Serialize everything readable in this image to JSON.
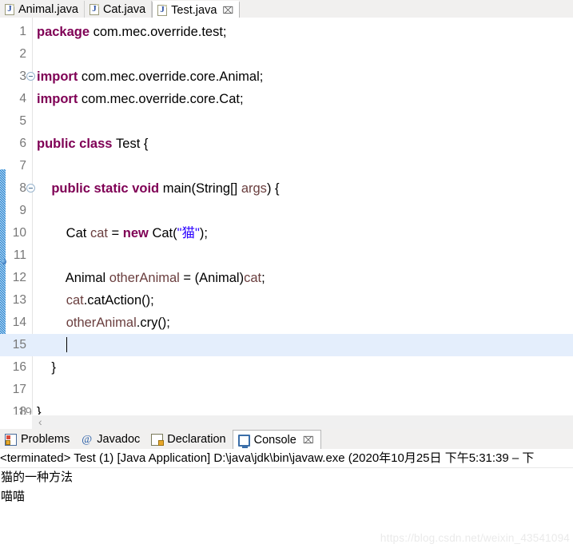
{
  "editor_tabs": [
    {
      "label": "Animal.java",
      "icon": "java-file-icon",
      "active": false,
      "closeable": false
    },
    {
      "label": "Cat.java",
      "icon": "java-file-icon",
      "active": false,
      "closeable": false
    },
    {
      "label": "Test.java",
      "icon": "java-file-icon",
      "active": true,
      "closeable": true,
      "close_glyph": "⌧"
    }
  ],
  "editor": {
    "filename": "Test.java",
    "cursor_line": 15,
    "partial_line_number": "19",
    "scroll_left_arrow": "‹",
    "lines": [
      {
        "num": "1",
        "fold": false,
        "tokens": [
          {
            "t": "package ",
            "c": "kw"
          },
          {
            "t": "com.mec.override.test;",
            "c": "plain"
          }
        ]
      },
      {
        "num": "2",
        "fold": false,
        "tokens": []
      },
      {
        "num": "3",
        "fold": true,
        "tokens": [
          {
            "t": "import ",
            "c": "kw"
          },
          {
            "t": "com.mec.override.core.Animal;",
            "c": "plain"
          }
        ]
      },
      {
        "num": "4",
        "fold": false,
        "tokens": [
          {
            "t": "import ",
            "c": "kw"
          },
          {
            "t": "com.mec.override.core.Cat;",
            "c": "plain"
          }
        ]
      },
      {
        "num": "5",
        "fold": false,
        "tokens": []
      },
      {
        "num": "6",
        "fold": false,
        "tokens": [
          {
            "t": "public class ",
            "c": "kw"
          },
          {
            "t": "Test {",
            "c": "plain"
          }
        ]
      },
      {
        "num": "7",
        "fold": false,
        "tokens": []
      },
      {
        "num": "8",
        "fold": true,
        "tokens": [
          {
            "t": "    ",
            "c": "plain"
          },
          {
            "t": "public static void ",
            "c": "kw"
          },
          {
            "t": "main(String[] ",
            "c": "plain"
          },
          {
            "t": "args",
            "c": "var"
          },
          {
            "t": ") {",
            "c": "plain"
          }
        ]
      },
      {
        "num": "9",
        "fold": false,
        "tokens": []
      },
      {
        "num": "10",
        "fold": false,
        "tokens": [
          {
            "t": "        Cat ",
            "c": "plain"
          },
          {
            "t": "cat",
            "c": "var"
          },
          {
            "t": " = ",
            "c": "plain"
          },
          {
            "t": "new ",
            "c": "kw"
          },
          {
            "t": "Cat(",
            "c": "plain"
          },
          {
            "t": "\"猫\"",
            "c": "str"
          },
          {
            "t": ");",
            "c": "plain"
          }
        ]
      },
      {
        "num": "11",
        "fold": false,
        "tokens": []
      },
      {
        "num": "12",
        "fold": false,
        "marker": true,
        "tokens": [
          {
            "t": "        Animal ",
            "c": "plain"
          },
          {
            "t": "otherAnimal",
            "c": "var"
          },
          {
            "t": " = (Animal)",
            "c": "plain"
          },
          {
            "t": "cat",
            "c": "var"
          },
          {
            "t": ";",
            "c": "plain"
          }
        ]
      },
      {
        "num": "13",
        "fold": false,
        "tokens": [
          {
            "t": "        ",
            "c": "plain"
          },
          {
            "t": "cat",
            "c": "var"
          },
          {
            "t": ".catAction();",
            "c": "plain"
          }
        ]
      },
      {
        "num": "14",
        "fold": false,
        "tokens": [
          {
            "t": "        ",
            "c": "plain"
          },
          {
            "t": "otherAnimal",
            "c": "var"
          },
          {
            "t": ".cry();",
            "c": "plain"
          }
        ]
      },
      {
        "num": "15",
        "fold": false,
        "highlight": true,
        "cursor": true,
        "tokens": [
          {
            "t": "        ",
            "c": "plain"
          }
        ]
      },
      {
        "num": "16",
        "fold": false,
        "tokens": [
          {
            "t": "    }",
            "c": "plain"
          }
        ]
      },
      {
        "num": "17",
        "fold": false,
        "tokens": []
      },
      {
        "num": "18",
        "fold": false,
        "tokens": [
          {
            "t": "}",
            "c": "plain"
          }
        ]
      }
    ]
  },
  "view_tabs": [
    {
      "label": "Problems",
      "icon": "problems-icon",
      "active": false,
      "closeable": false
    },
    {
      "label": "Javadoc",
      "icon": "javadoc-icon",
      "active": false,
      "closeable": false,
      "glyph": "@"
    },
    {
      "label": "Declaration",
      "icon": "declaration-icon",
      "active": false,
      "closeable": false
    },
    {
      "label": "Console",
      "icon": "console-icon",
      "active": true,
      "closeable": true,
      "close_glyph": "⌧"
    }
  ],
  "console": {
    "header": "<terminated> Test (1) [Java Application] D:\\java\\jdk\\bin\\javaw.exe  (2020年10月25日 下午5:31:39 – 下",
    "output": [
      "猫的一种方法",
      "喵喵"
    ]
  },
  "watermark": {
    "text": "https://blog.csdn.net/weixin_43541094"
  },
  "colors": {
    "keyword": "#7f0055",
    "string": "#2a00ff",
    "local_var": "#6a3e3e",
    "line_number": "#777777",
    "current_line_highlight": "#e4eefc",
    "change_bar": "#1d7fd0",
    "tab_bar_bg": "#f1f0ef"
  }
}
